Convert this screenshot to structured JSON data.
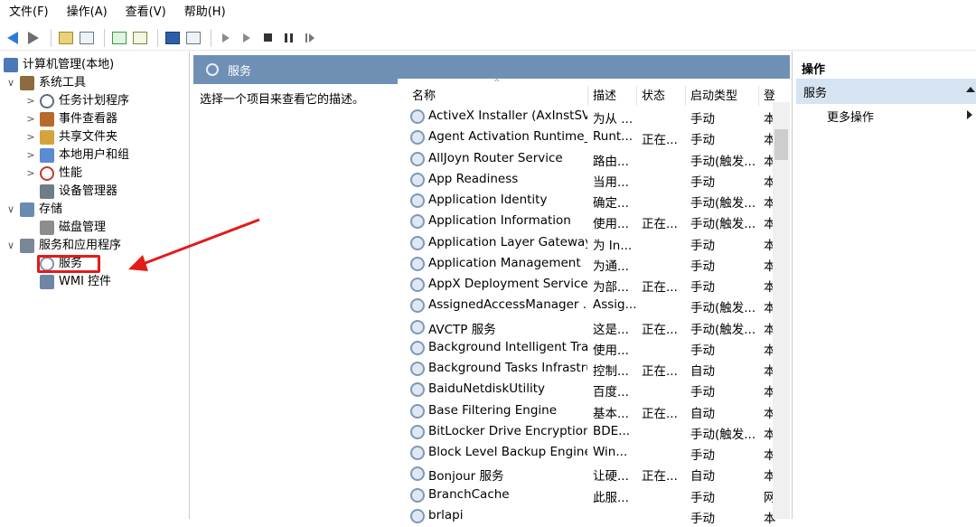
{
  "menu": [
    "文件(F)",
    "操作(A)",
    "查看(V)",
    "帮助(H)"
  ],
  "tree": [
    {
      "label": "计算机管理(本地)",
      "icon": "computer-icon",
      "level": 0,
      "twist": ""
    },
    {
      "label": "系统工具",
      "icon": "tools-icon",
      "level": 1,
      "twist": "∨"
    },
    {
      "label": "任务计划程序",
      "icon": "clock-icon",
      "level": 2,
      "twist": ">"
    },
    {
      "label": "事件查看器",
      "icon": "event-viewer-icon",
      "level": 2,
      "twist": ">"
    },
    {
      "label": "共享文件夹",
      "icon": "shared-folder-icon",
      "level": 2,
      "twist": ">"
    },
    {
      "label": "本地用户和组",
      "icon": "users-icon",
      "level": 2,
      "twist": ">"
    },
    {
      "label": "性能",
      "icon": "performance-icon",
      "level": 2,
      "twist": ">"
    },
    {
      "label": "设备管理器",
      "icon": "device-manager-icon",
      "level": 2,
      "twist": ""
    },
    {
      "label": "存储",
      "icon": "storage-icon",
      "level": 1,
      "twist": "∨"
    },
    {
      "label": "磁盘管理",
      "icon": "disk-icon",
      "level": 2,
      "twist": ""
    },
    {
      "label": "服务和应用程序",
      "icon": "services-apps-icon",
      "level": 1,
      "twist": "∨"
    },
    {
      "label": "服务",
      "icon": "gear-icon",
      "level": 2,
      "twist": ""
    },
    {
      "label": "WMI 控件",
      "icon": "wmi-icon",
      "level": 2,
      "twist": ""
    }
  ],
  "middle": {
    "header": "服务",
    "description": "选择一个项目来查看它的描述。",
    "columns": [
      "名称",
      "描述",
      "状态",
      "启动类型",
      "登"
    ]
  },
  "services": [
    {
      "name": "ActiveX Installer (AxInstSV)",
      "desc": "为从 ...",
      "status": "",
      "startup": "手动",
      "login": "本"
    },
    {
      "name": "Agent Activation Runtime_...",
      "desc": "Runt...",
      "status": "正在...",
      "startup": "手动",
      "login": "本"
    },
    {
      "name": "AllJoyn Router Service",
      "desc": "路由...",
      "status": "",
      "startup": "手动(触发...",
      "login": "本"
    },
    {
      "name": "App Readiness",
      "desc": "当用...",
      "status": "",
      "startup": "手动",
      "login": "本"
    },
    {
      "name": "Application Identity",
      "desc": "确定...",
      "status": "",
      "startup": "手动(触发...",
      "login": "本"
    },
    {
      "name": "Application Information",
      "desc": "使用...",
      "status": "正在...",
      "startup": "手动(触发...",
      "login": "本"
    },
    {
      "name": "Application Layer Gateway ...",
      "desc": "为 In...",
      "status": "",
      "startup": "手动",
      "login": "本"
    },
    {
      "name": "Application Management",
      "desc": "为通...",
      "status": "",
      "startup": "手动",
      "login": "本"
    },
    {
      "name": "AppX Deployment Service ...",
      "desc": "为部...",
      "status": "正在...",
      "startup": "手动",
      "login": "本"
    },
    {
      "name": "AssignedAccessManager ...",
      "desc": "Assig...",
      "status": "",
      "startup": "手动(触发...",
      "login": "本"
    },
    {
      "name": "AVCTP 服务",
      "desc": "这是...",
      "status": "正在...",
      "startup": "手动(触发...",
      "login": "本"
    },
    {
      "name": "Background Intelligent Tra...",
      "desc": "使用...",
      "status": "",
      "startup": "手动",
      "login": "本"
    },
    {
      "name": "Background Tasks Infrastru...",
      "desc": "控制...",
      "status": "正在...",
      "startup": "自动",
      "login": "本"
    },
    {
      "name": "BaiduNetdiskUtility",
      "desc": "百度...",
      "status": "",
      "startup": "手动",
      "login": "本"
    },
    {
      "name": "Base Filtering Engine",
      "desc": "基本...",
      "status": "正在...",
      "startup": "自动",
      "login": "本"
    },
    {
      "name": "BitLocker Drive Encryption ...",
      "desc": "BDE...",
      "status": "",
      "startup": "手动(触发...",
      "login": "本"
    },
    {
      "name": "Block Level Backup Engine ...",
      "desc": "Win...",
      "status": "",
      "startup": "手动",
      "login": "本"
    },
    {
      "name": "Bonjour 服务",
      "desc": "让硬...",
      "status": "正在...",
      "startup": "自动",
      "login": "本"
    },
    {
      "name": "BranchCache",
      "desc": "此服...",
      "status": "",
      "startup": "手动",
      "login": "网"
    },
    {
      "name": "brlapi",
      "desc": "",
      "status": "",
      "startup": "手动",
      "login": "本"
    }
  ],
  "actions": {
    "title": "操作",
    "section": "服务",
    "more": "更多操作"
  },
  "colors": {
    "header_bg": "#6f8fb5",
    "annotation": "#e31b1b",
    "section_bg": "#d6e3f1"
  }
}
